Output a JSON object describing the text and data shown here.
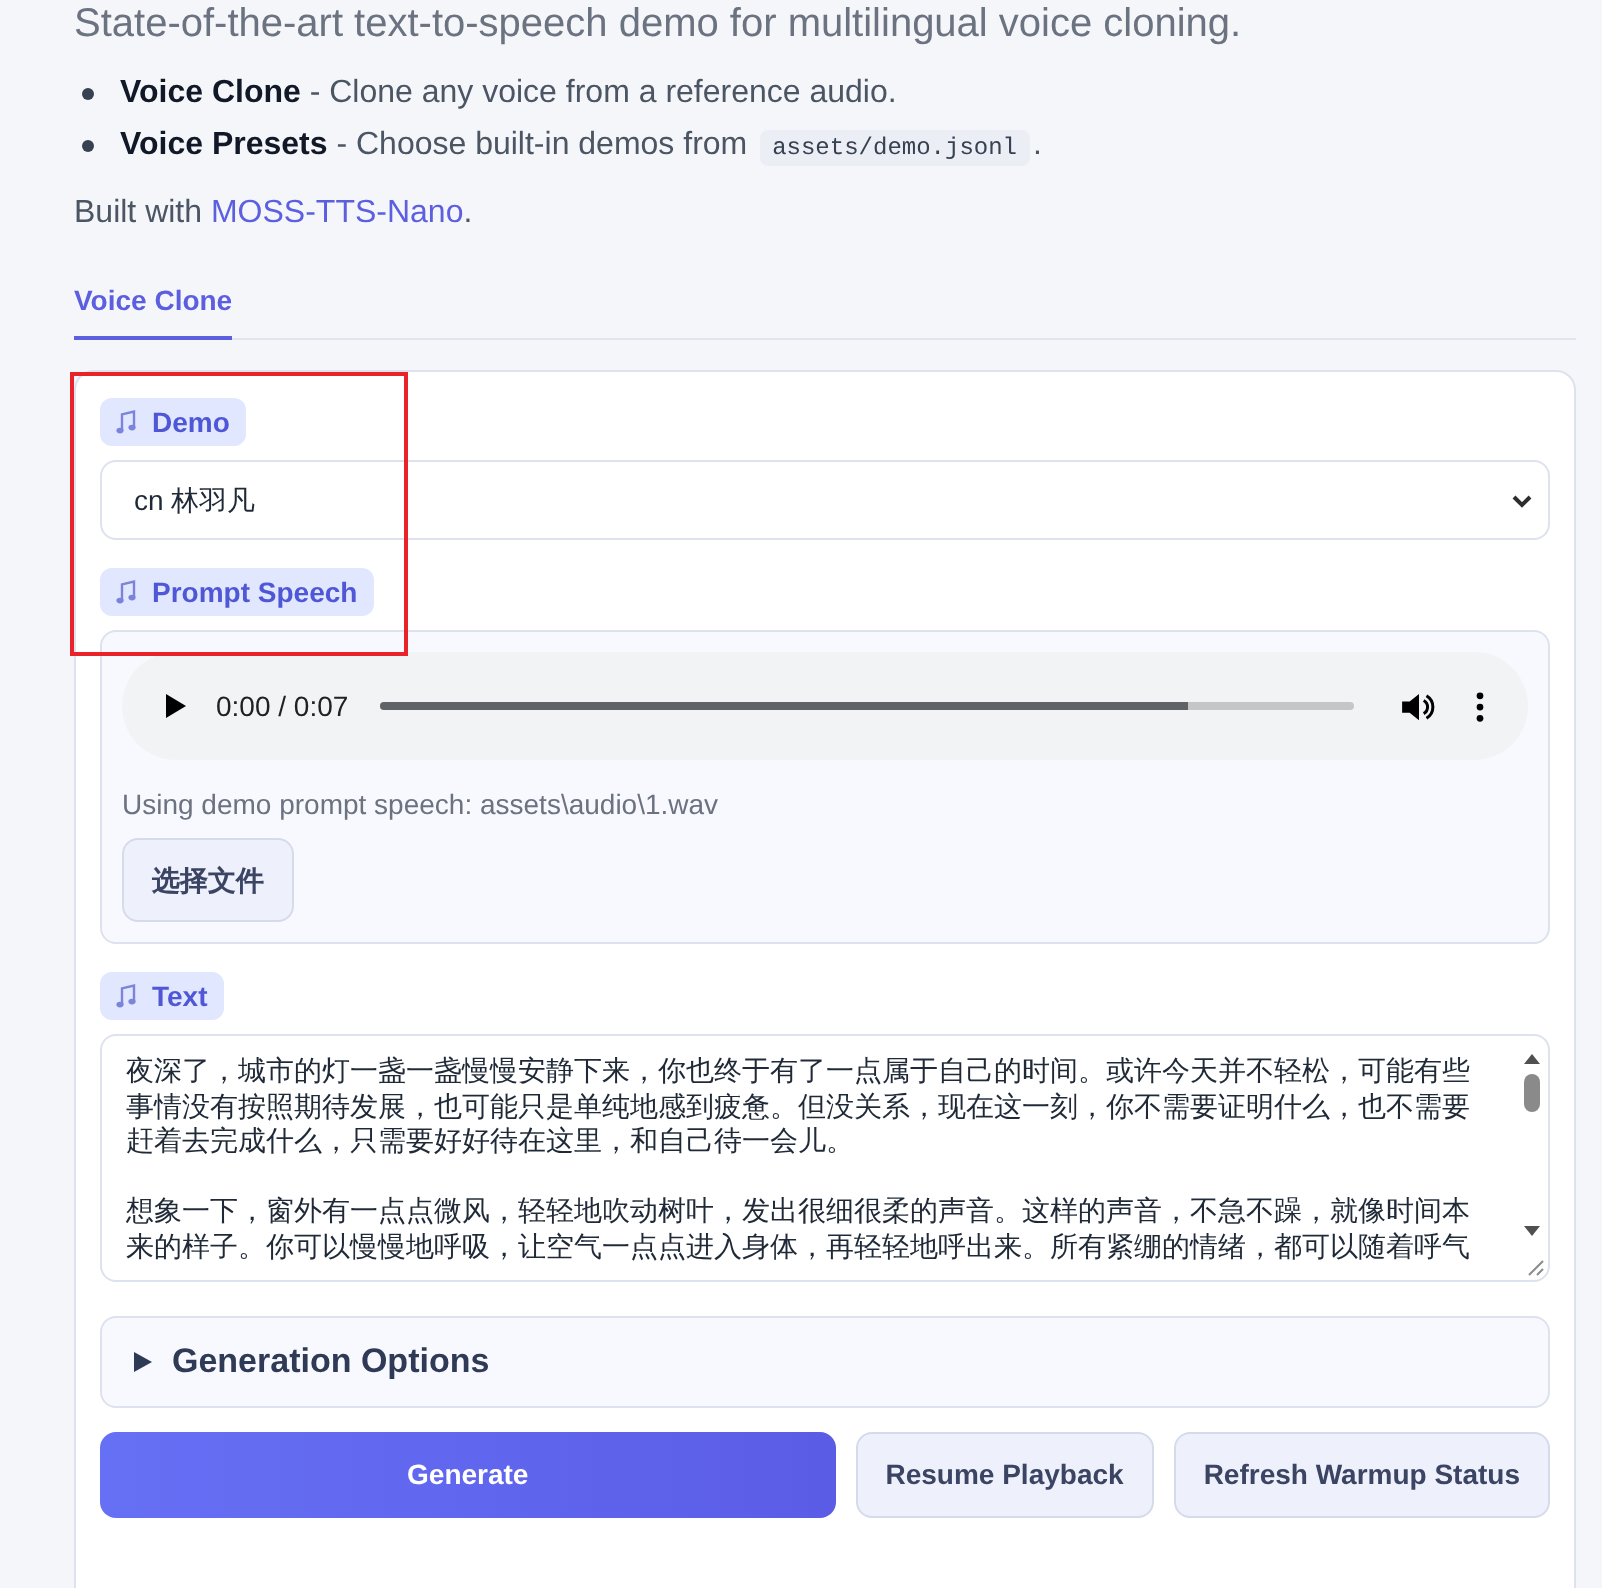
{
  "description": {
    "text": "State-of-the-art text-to-speech demo for multilingual voice cloning."
  },
  "features": [
    {
      "text": "**Voice Clone** - Clone any voice from a reference audio."
    },
    {
      "text": "**Voice Presets** - Choose built-in demos from",
      "code": "assets/demo.jsonl",
      "suffix": "."
    }
  ],
  "credit": {
    "text": "Built with",
    "link": "MOSS-TTS-Nano",
    "suffix": "."
  },
  "tabs": [
    {
      "label": "Voice Clone",
      "selected": true
    }
  ],
  "demo": {
    "label": "Demo",
    "value": "cn 林羽凡"
  },
  "prompt_speech": {
    "label": "Prompt Speech",
    "player": {
      "time": "0:00 / 0:07",
      "level": 0.83
    },
    "status": "Using demo prompt speech: assets\\audio\\1.wav",
    "upload_button": "选择文件"
  },
  "text": {
    "label": "Text",
    "value": [
      "夜深了，城市的灯一盏一盏慢慢安静下来，你也终于有了一点属于自己的时间。或许今天并不轻松，可能有些事情没有按照期待发展，也可能只是单纯地感到疲惫。但没关系，现在这一刻，你不需要证明什么，也不需要赶着去完成什么，只需要好好待在这里，和自己待一会儿。",
      "想象一下，窗外有一点点微风，轻轻地吹动树叶，发出很细很柔的声音。这样的声音，不急不躁，就像时间本来的样子。你可以慢慢地呼吸，让空气一点点进入身体，再轻轻地呼出来。所有紧绷的情绪，都可以随着呼气"
    ]
  },
  "generation_options": {
    "label": "Generation Options",
    "expanded": false
  },
  "buttons": [
    {
      "label": "Generate",
      "kind": "primary"
    },
    {
      "label": "Resume Playback",
      "kind": "secondary"
    },
    {
      "label": "Refresh Warmup Status",
      "kind": "secondary"
    }
  ],
  "annotation": {
    "kind": "box"
  }
}
